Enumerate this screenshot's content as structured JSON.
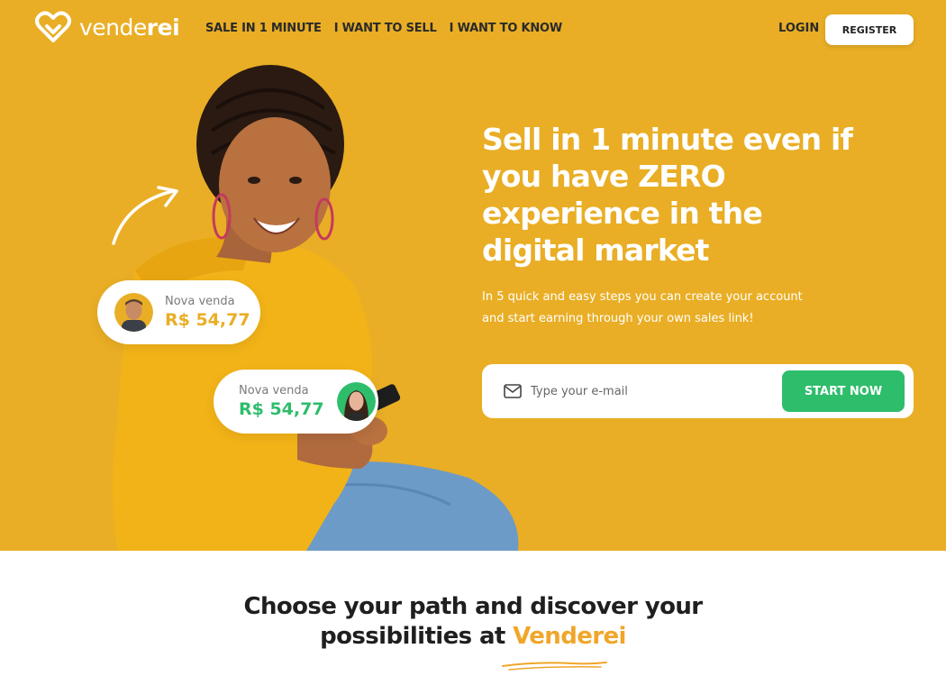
{
  "header": {
    "logo_text_light": "vende",
    "logo_text_bold": "rei",
    "nav": [
      "SALE IN 1 MINUTE",
      "I WANT TO SELL",
      "I WANT TO KNOW"
    ],
    "login_label": "LOGIN",
    "register_label": "REGISTER"
  },
  "hero": {
    "background_color": "#e9ae25",
    "headline": "Sell in 1 minute even if you have ZERO experience in the digital market",
    "subtext": "In 5 quick and easy steps you can create your account and start earning through your own sales link!",
    "notifications": [
      {
        "label": "Nova venda",
        "amount": "R$ 54,77",
        "color": "#e9ae25"
      },
      {
        "label": "Nova venda",
        "amount": "R$ 54,77",
        "color": "#2ebd6b"
      }
    ],
    "form": {
      "email_placeholder": "Type your e-mail",
      "email_value": "",
      "start_label": "START NOW",
      "button_color": "#2ebd6b"
    }
  },
  "section": {
    "title_line1": "Choose your path and discover your",
    "title_line2_prefix": "possibilities at ",
    "title_brand": "Venderei",
    "brand_color": "#f0a62a"
  }
}
